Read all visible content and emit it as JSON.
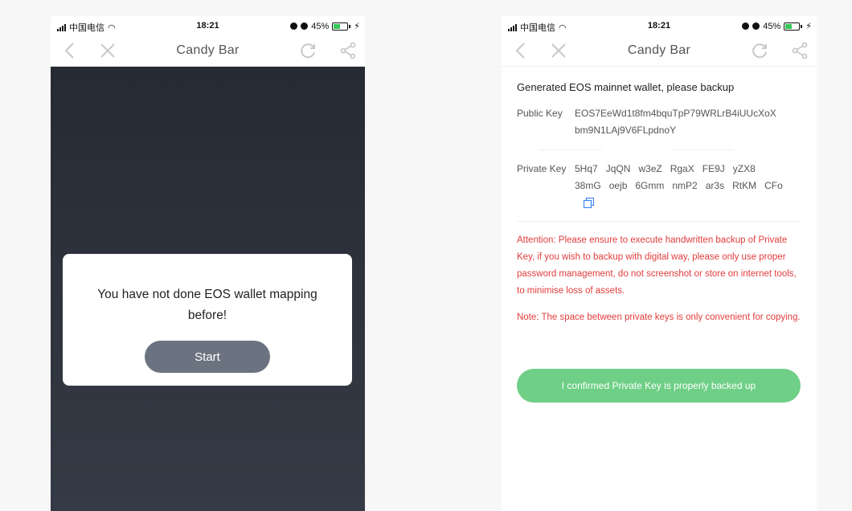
{
  "status_bar": {
    "carrier": "中国电信",
    "time": "18:21",
    "battery": "45%"
  },
  "icons": {
    "back": "chevron-left-icon",
    "close": "close-icon",
    "refresh": "refresh-icon",
    "share": "share-icon",
    "copy": "copy-icon"
  },
  "left_screen": {
    "nav_title": "Candy Bar",
    "modal": {
      "message": "You have not done EOS wallet mapping before!",
      "button_label": "Start"
    }
  },
  "right_screen": {
    "nav_title": "Candy Bar",
    "heading": "Generated EOS mainnet wallet, please backup",
    "public_key": {
      "label": "Public Key",
      "line1": "EOS7EeWd1t8fm4bquTpP79WRLrB4iUUcXoX",
      "line2": "bm9N1LAj9V6FLpdnoY"
    },
    "private_key": {
      "label": "Private Key",
      "groups": [
        "5Hq7",
        "JqQN",
        "w3eZ",
        "RgaX",
        "FE9J",
        "yZX8",
        "38mG",
        "oejb",
        "6Gmm",
        "nmP2",
        "ar3s",
        "RtKM",
        "CFo"
      ]
    },
    "attention_text": "Attention:  Please ensure to execute handwritten backup of Private Key, if you wish to backup with digital way, please only use proper password management, do not screenshot or store on internet tools, to minimise loss of assets.",
    "note_text": "Note: The space between private keys is only convenient for copying.",
    "confirm_button": "I confirmed Private Key is properly backed up"
  },
  "colors": {
    "accent_green": "#6fcf87",
    "warning_red": "#e23c3c",
    "modal_button": "#6b7280"
  }
}
